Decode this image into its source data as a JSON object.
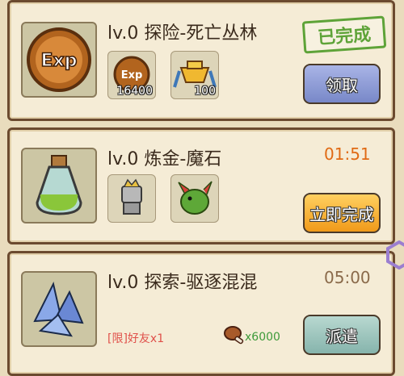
{
  "tasks": [
    {
      "title": "lv.0 探险-死亡丛林",
      "status_stamp": "已完成",
      "rewards": [
        {
          "icon": "exp-coin-icon",
          "amount": "16400"
        },
        {
          "icon": "golden-chest-icon",
          "amount": "100"
        }
      ],
      "button": "领取"
    },
    {
      "title": "lv.0 炼金-魔石",
      "timer": "01:51",
      "rewards": [
        {
          "icon": "robot-creature-icon"
        },
        {
          "icon": "green-dragon-icon"
        }
      ],
      "button": "立即完成"
    },
    {
      "title": "lv.0 探索-驱逐混混",
      "timer": "05:00",
      "requirement": "[限]好友x1",
      "cost": "x6000",
      "button": "派遣"
    }
  ],
  "icons": {
    "task1": "exp-coin-icon",
    "task2": "green-potion-icon",
    "task3": "blue-crystal-icon",
    "cost": "meat-icon",
    "side": "hexagon-icon"
  },
  "colors": {
    "completed": "#5ea338",
    "timer": "#e06a14",
    "requirement": "#e0504a",
    "cost": "#3e9a3a"
  }
}
